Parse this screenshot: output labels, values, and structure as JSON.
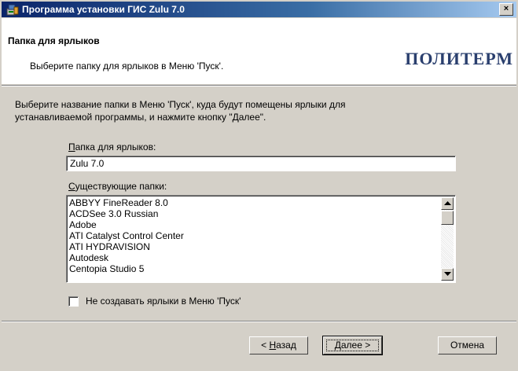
{
  "window": {
    "title": "Программа установки ГИС Zulu 7.0",
    "close_label": "×"
  },
  "header": {
    "title": "Папка для ярлыков",
    "subtitle": "Выберите папку для ярлыков в Меню 'Пуск'.",
    "logo_text": "ПОЛИТЕРМ"
  },
  "body": {
    "description_line1": "Выберите название папки в Меню 'Пуск', куда будут помещены ярлыки для",
    "description_line2": "устанавливаемой программы, и нажмите кнопку \"Далее\".",
    "folder_label_accel": "П",
    "folder_label_rest": "апка для ярлыков:",
    "folder_value": "Zulu 7.0",
    "existing_label_accel": "С",
    "existing_label_rest": "уществующие папки:",
    "existing_folders": [
      "ABBYY FineReader 8.0",
      "ACDSee 3.0 Russian",
      "Adobe",
      "ATI Catalyst Control Center",
      "ATI HYDRAVISION",
      "Autodesk",
      "Centopia Studio 5"
    ],
    "no_shortcuts_label": "Не создавать ярлыки в Меню 'Пуск'",
    "no_shortcuts_checked": false
  },
  "buttons": {
    "back_prefix": "< ",
    "back_accel": "Н",
    "back_rest": "азад",
    "next_accel": "Д",
    "next_rest": "алее >",
    "cancel": "Отмена"
  },
  "colors": {
    "title_bar": "#0a246a",
    "dialog_face": "#d4d0c8",
    "logo": "#2a3f6e"
  }
}
